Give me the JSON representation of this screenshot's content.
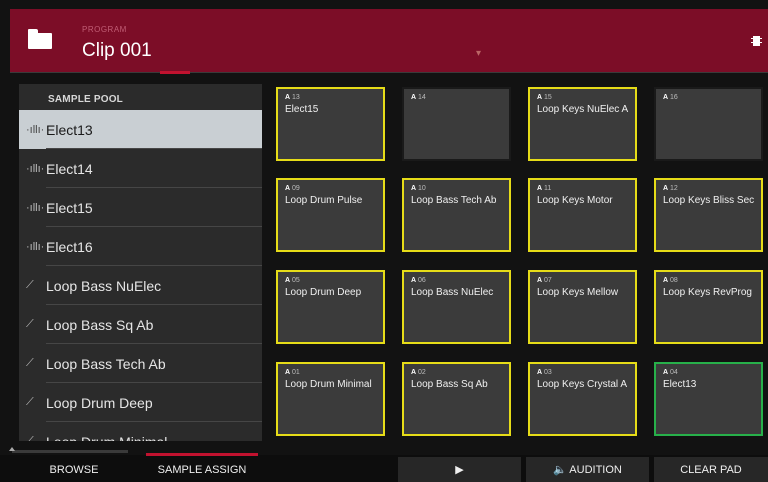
{
  "header": {
    "label": "PROGRAM",
    "program_name": "Clip 001",
    "folder_icon": "folder-icon",
    "chip_icon": "chip-icon"
  },
  "pool": {
    "title": "SAMPLE POOL",
    "items": [
      {
        "label": "Elect13",
        "icon": "waveform-icon",
        "glyph": "·ıllı·"
      },
      {
        "label": "Elect14",
        "icon": "waveform-icon",
        "glyph": "·ıllı·"
      },
      {
        "label": "Elect15",
        "icon": "waveform-icon",
        "glyph": "·ıllı·"
      },
      {
        "label": "Elect16",
        "icon": "waveform-icon",
        "glyph": "·ıllı·"
      },
      {
        "label": "Loop Bass NuElec",
        "icon": "loop-icon",
        "glyph": "⟋"
      },
      {
        "label": "Loop Bass Sq Ab",
        "icon": "loop-icon",
        "glyph": "⟋"
      },
      {
        "label": "Loop Bass Tech Ab",
        "icon": "loop-icon",
        "glyph": "⟋"
      },
      {
        "label": "Loop Drum Deep",
        "icon": "loop-icon",
        "glyph": "⟋"
      },
      {
        "label": "Loop Drum Minimal",
        "icon": "loop-icon",
        "glyph": "⟋"
      }
    ],
    "selected_index": 0
  },
  "pads": [
    {
      "bank": "A",
      "num": "13",
      "name": "Elect15",
      "state": "yellow"
    },
    {
      "bank": "A",
      "num": "14",
      "name": "",
      "state": "none"
    },
    {
      "bank": "A",
      "num": "15",
      "name": "Loop Keys NuElec A",
      "state": "yellow"
    },
    {
      "bank": "A",
      "num": "16",
      "name": "",
      "state": "none"
    },
    {
      "bank": "A",
      "num": "09",
      "name": "Loop Drum Pulse",
      "state": "yellow"
    },
    {
      "bank": "A",
      "num": "10",
      "name": "Loop Bass Tech Ab",
      "state": "yellow"
    },
    {
      "bank": "A",
      "num": "11",
      "name": "Loop Keys Motor",
      "state": "yellow"
    },
    {
      "bank": "A",
      "num": "12",
      "name": "Loop Keys Bliss Sec",
      "state": "yellow"
    },
    {
      "bank": "A",
      "num": "05",
      "name": "Loop Drum Deep",
      "state": "yellow"
    },
    {
      "bank": "A",
      "num": "06",
      "name": "Loop Bass NuElec",
      "state": "yellow"
    },
    {
      "bank": "A",
      "num": "07",
      "name": "Loop Keys Mellow",
      "state": "yellow"
    },
    {
      "bank": "A",
      "num": "08",
      "name": "Loop Keys RevProg",
      "state": "yellow"
    },
    {
      "bank": "A",
      "num": "01",
      "name": "Loop Drum Minimal",
      "state": "yellow"
    },
    {
      "bank": "A",
      "num": "02",
      "name": "Loop Bass Sq Ab",
      "state": "yellow"
    },
    {
      "bank": "A",
      "num": "03",
      "name": "Loop Keys Crystal A",
      "state": "yellow"
    },
    {
      "bank": "A",
      "num": "04",
      "name": "Elect13",
      "state": "green"
    }
  ],
  "bottom": {
    "browse": "BROWSE",
    "sample_assign": "SAMPLE ASSIGN",
    "play": "▶",
    "audition": "🔈 AUDITION",
    "clear_pad": "CLEAR PAD"
  },
  "colors": {
    "header_bg": "#7c0d27",
    "accent_red": "#c1122f",
    "pad_yellow": "#e6dc18",
    "pad_green": "#27b04a",
    "selected_row": "#c9cfd3"
  }
}
